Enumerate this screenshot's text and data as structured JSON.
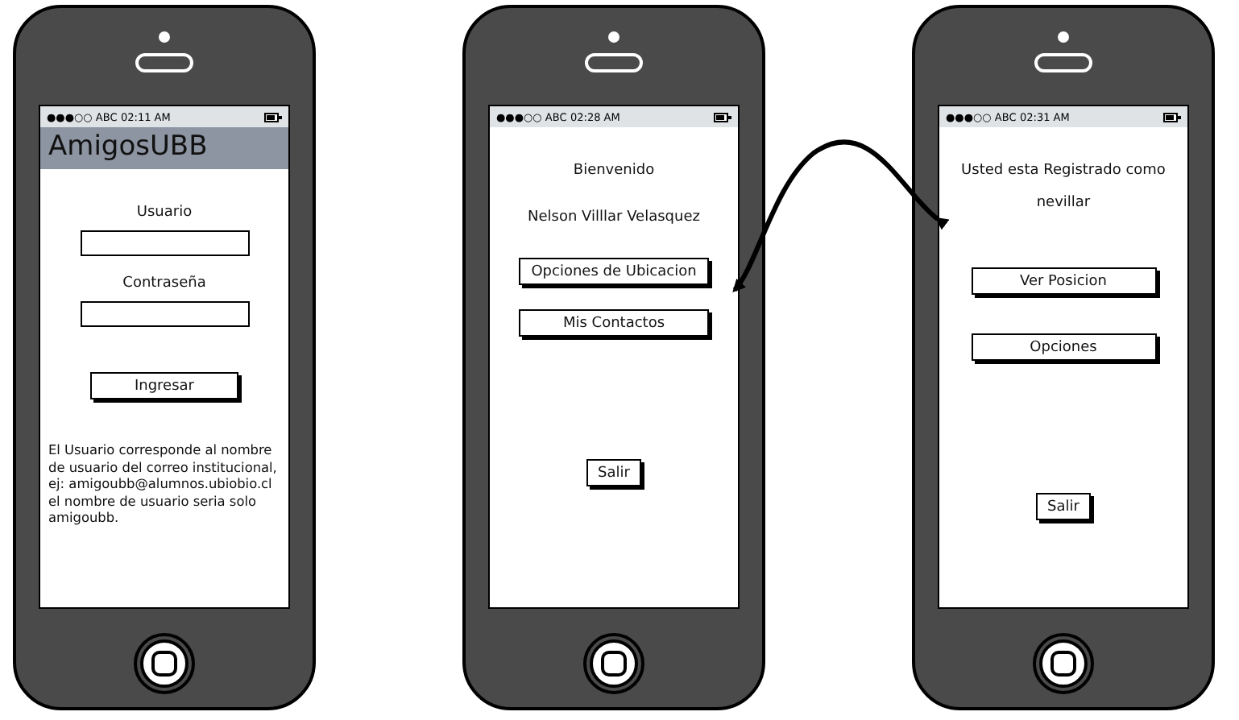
{
  "phones": [
    {
      "status": {
        "carrier": "●●●○○ ABC",
        "time": "02:11 AM"
      },
      "header": "AmigosUBB",
      "items": [
        {
          "kind": "label",
          "text": "Usuario"
        },
        {
          "kind": "field"
        },
        {
          "kind": "label",
          "text": "Contraseña"
        },
        {
          "kind": "field"
        },
        {
          "kind": "button",
          "text": "Ingresar"
        },
        {
          "kind": "paragraph",
          "text": "El Usuario corresponde al nombre de usuario del correo institucional, ej: amigoubb@alumnos.ubiobio.cl el nombre de usuario seria solo amigoubb."
        }
      ]
    },
    {
      "status": {
        "carrier": "●●●○○ ABC",
        "time": "02:28 AM"
      },
      "items": [
        {
          "kind": "label",
          "text": "Bienvenido"
        },
        {
          "kind": "label",
          "text": "Nelson Villlar Velasquez"
        },
        {
          "kind": "button",
          "text": "Opciones de Ubicacion"
        },
        {
          "kind": "button",
          "text": "Mis Contactos"
        },
        {
          "kind": "small-button",
          "text": "Salir"
        }
      ]
    },
    {
      "status": {
        "carrier": "●●●○○ ABC",
        "time": "02:31 AM"
      },
      "items": [
        {
          "kind": "label",
          "text": "Usted esta Registrado como"
        },
        {
          "kind": "label",
          "text": "nevillar"
        },
        {
          "kind": "button",
          "text": "Ver Posicion"
        },
        {
          "kind": "button",
          "text": "Opciones"
        },
        {
          "kind": "small-button",
          "text": "Salir"
        }
      ]
    }
  ]
}
